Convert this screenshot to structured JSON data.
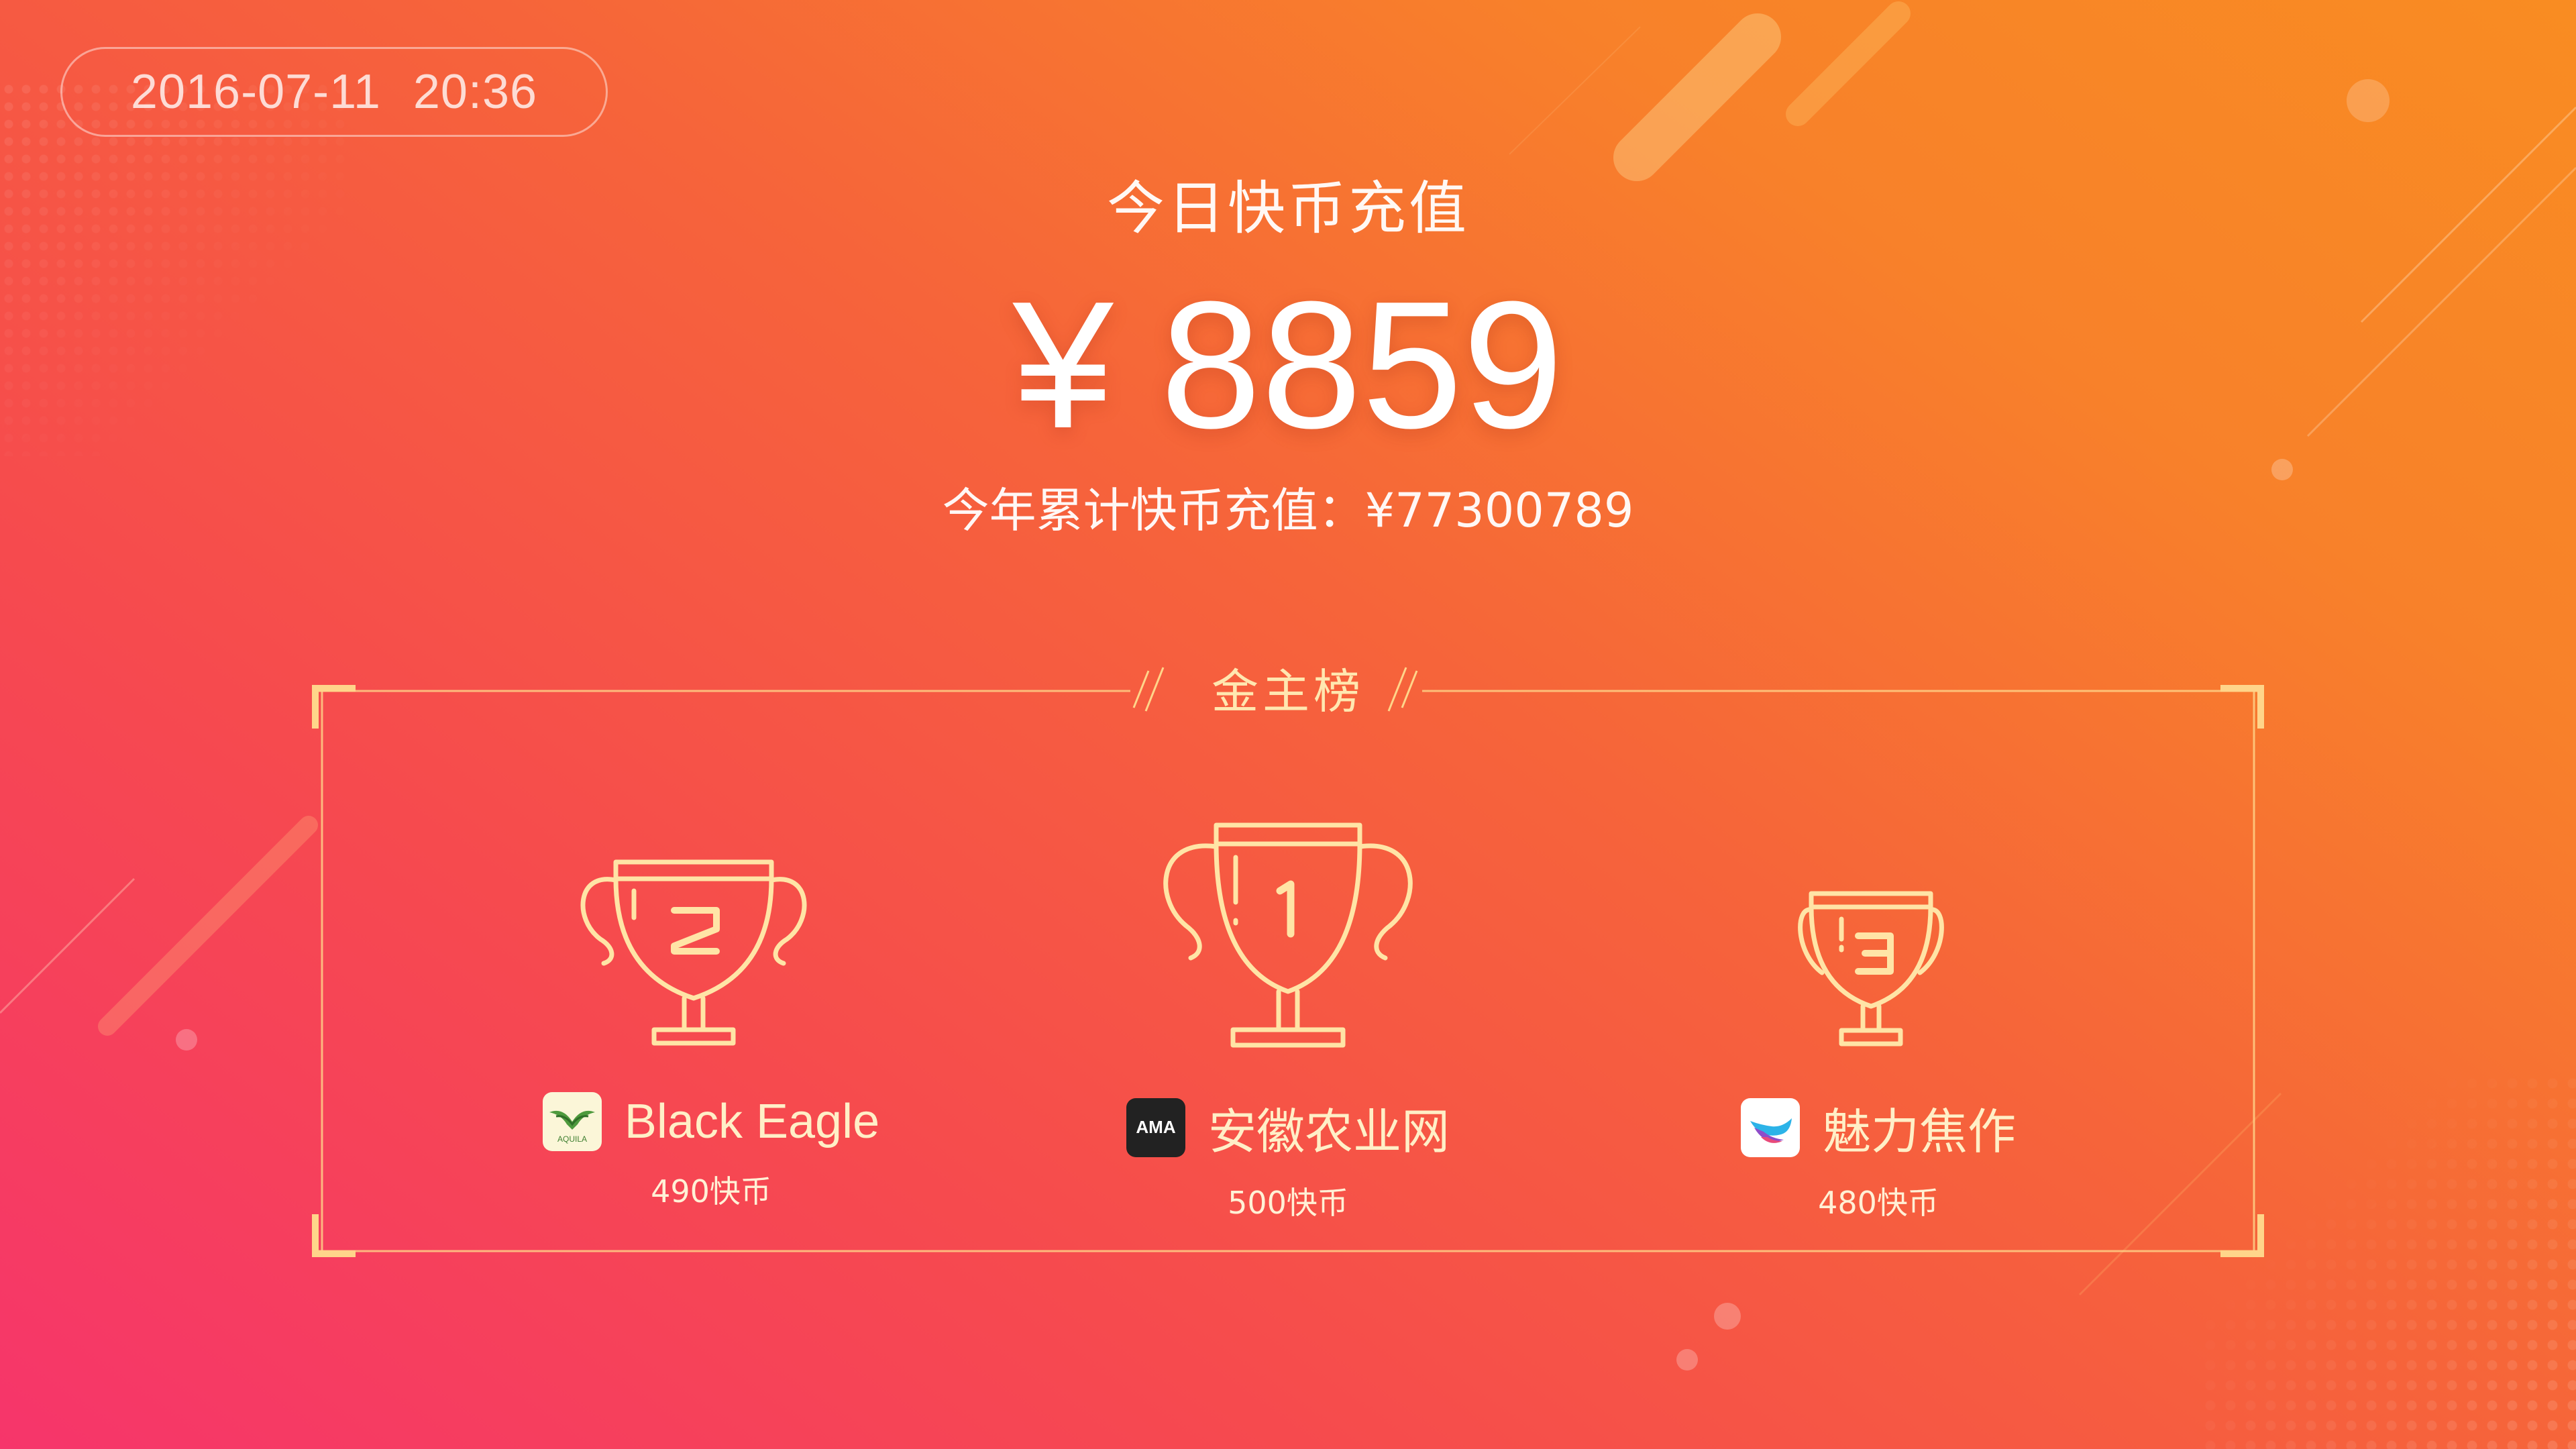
{
  "date": "2016-07-11",
  "time": "20:36",
  "heading": "今日快币充值",
  "today_amount": {
    "currency": "¥",
    "value": "8859"
  },
  "yearly": {
    "text": "今年累计快币充值：¥77300789"
  },
  "board": {
    "title": "金主榜",
    "entries": [
      {
        "rank": "2",
        "name": "Black Eagle",
        "coins": "490快币",
        "logo": "aquila-eagle-logo",
        "logo_text": "AQUILA"
      },
      {
        "rank": "1",
        "name": "安徽农业网",
        "coins": "500快币",
        "logo": "ama-logo",
        "logo_text": "AMA"
      },
      {
        "rank": "3",
        "name": "魅力焦作",
        "coins": "480快币",
        "logo": "bird-logo"
      }
    ]
  },
  "colors": {
    "gradient_start": "#F6356B",
    "gradient_end": "#F98C22",
    "gold": "#FFE7B0",
    "frame": "#FFD58A"
  }
}
